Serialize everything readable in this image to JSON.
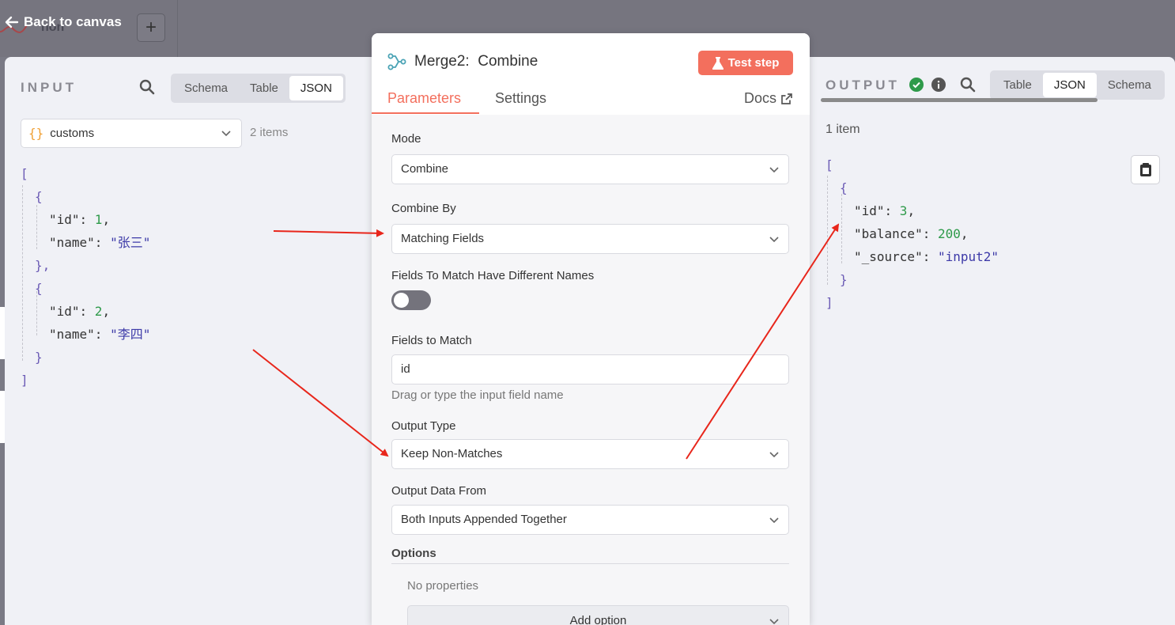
{
  "topbar": {
    "back_label": "Back to canvas",
    "bg_tab_label": "non"
  },
  "input": {
    "title": "INPUT",
    "views": [
      "Schema",
      "Table",
      "JSON"
    ],
    "active_view": "JSON",
    "node_name": "customs",
    "items_count": "2 items",
    "json": [
      {
        "id": 1,
        "name": "张三"
      },
      {
        "id": 2,
        "name": "李四"
      }
    ]
  },
  "node": {
    "title": "Merge2:  Combine",
    "test_step": "Test step",
    "tabs": [
      "Parameters",
      "Settings"
    ],
    "active_tab": "Parameters",
    "docs": "Docs",
    "fields": {
      "mode": {
        "label": "Mode",
        "value": "Combine"
      },
      "combine_by": {
        "label": "Combine By",
        "value": "Matching Fields"
      },
      "different_names": {
        "label": "Fields To Match Have Different Names",
        "value": false
      },
      "fields_to_match": {
        "label": "Fields to Match",
        "value": "id",
        "hint": "Drag or type the input field name"
      },
      "output_type": {
        "label": "Output Type",
        "value": "Keep Non-Matches"
      },
      "output_data_from": {
        "label": "Output Data From",
        "value": "Both Inputs Appended Together"
      }
    },
    "options": {
      "label": "Options",
      "empty": "No properties",
      "add_label": "Add option"
    }
  },
  "output": {
    "title": "OUTPUT",
    "views": [
      "Table",
      "JSON",
      "Schema"
    ],
    "active_view": "JSON",
    "items_count": "1 item",
    "json": [
      {
        "id": 3,
        "balance": 200,
        "_source": "input2"
      }
    ]
  },
  "colors": {
    "accent": "#f36f5d",
    "annotation_arrow": "#e8261b",
    "success": "#2e9a4a"
  }
}
